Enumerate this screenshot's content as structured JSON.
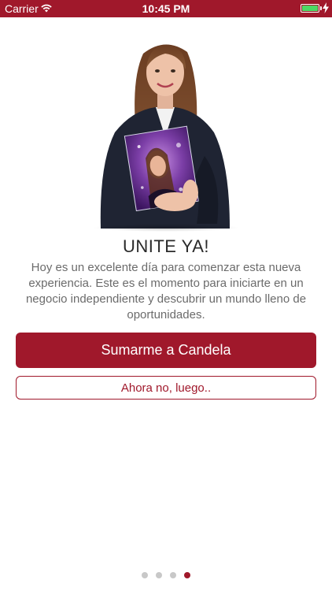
{
  "status_bar": {
    "carrier": "Carrier",
    "time": "10:45 PM",
    "battery_color": "#4cd964"
  },
  "hero": {
    "title": "UNITE YA!",
    "description": "Hoy es un excelente día para comenzar esta nueva experiencia. Este es el momento para iniciarte en un negocio independiente y descubrir un mundo lleno de oportunidades."
  },
  "actions": {
    "primary_label": "Sumarme a Candela",
    "secondary_label": "Ahora no, luego.."
  },
  "pagination": {
    "total": 4,
    "current": 4
  },
  "colors": {
    "brand": "#a0182b",
    "text": "#2a2a2a",
    "muted": "#6b6b6b"
  }
}
